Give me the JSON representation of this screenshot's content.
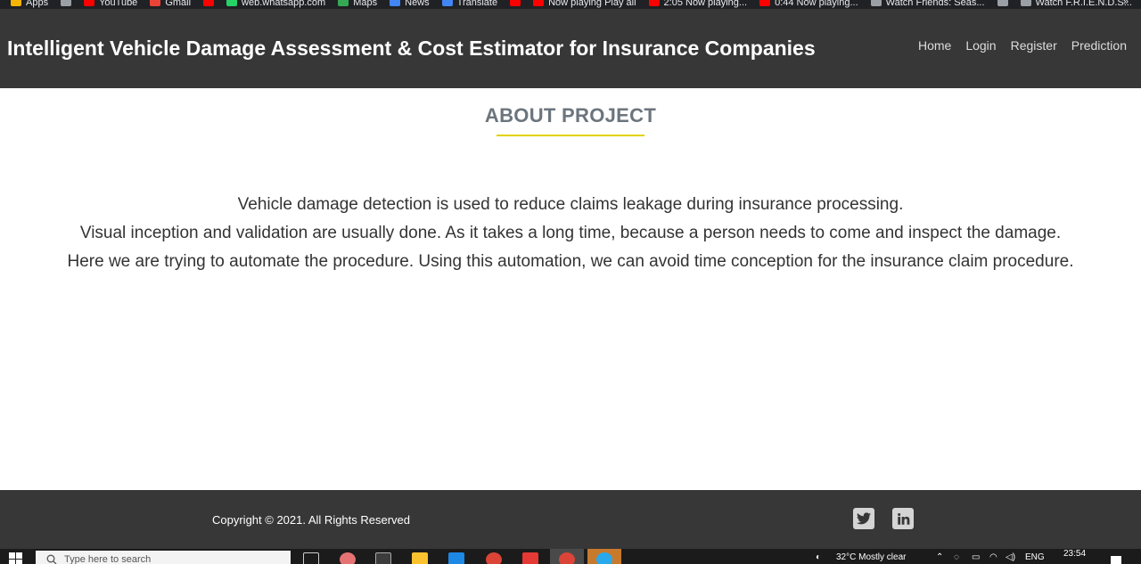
{
  "bookmarks": {
    "items": [
      {
        "label": "Apps",
        "color": "#f4b400"
      },
      {
        "label": "",
        "color": "#9aa0a6"
      },
      {
        "label": "YouTube",
        "color": "#ff0000"
      },
      {
        "label": "Gmail",
        "color": "#ea4335"
      },
      {
        "label": "",
        "color": "#ff0000"
      },
      {
        "label": "web.whatsapp.com",
        "color": "#25d366"
      },
      {
        "label": "Maps",
        "color": "#34a853"
      },
      {
        "label": "News",
        "color": "#4285f4"
      },
      {
        "label": "Translate",
        "color": "#4285f4"
      },
      {
        "label": "",
        "color": "#ff0000"
      },
      {
        "label": "Now playing Play all",
        "color": "#ff0000"
      },
      {
        "label": "2:05 Now playing...",
        "color": "#ff0000"
      },
      {
        "label": "0:44 Now playing...",
        "color": "#ff0000"
      },
      {
        "label": "Watch Friends: Seas...",
        "color": "#9aa0a6"
      },
      {
        "label": "",
        "color": "#9aa0a6"
      },
      {
        "label": "Watch F.R.I.E.N.D.S...",
        "color": "#9aa0a6"
      }
    ],
    "more_label": "»"
  },
  "header": {
    "title": "Intelligent Vehicle Damage Assessment & Cost Estimator for Insurance Companies",
    "nav": {
      "home": "Home",
      "login": "Login",
      "register": "Register",
      "prediction": "Prediction"
    }
  },
  "about": {
    "heading": "ABOUT PROJECT",
    "lines": [
      "Vehicle damage detection is used to reduce claims leakage during insurance processing.",
      "Visual inception and validation are usually done. As it takes a long time, because a person needs to come and inspect the damage.",
      "Here we are trying to automate the procedure. Using this automation, we can avoid time conception for the insurance claim procedure."
    ]
  },
  "footer": {
    "copyright": "Copyright © 2021. All Rights Reserved",
    "social": [
      {
        "icon": "twitter-icon"
      },
      {
        "icon": "linkedin-icon"
      }
    ]
  },
  "taskbar": {
    "search_placeholder": "Type here to search",
    "weather": "32°C  Mostly clear",
    "language": "ENG",
    "time": "23:54"
  },
  "colors": {
    "header_bg": "#373737",
    "accent_underline": "#e0d200",
    "heading_gray": "#6c757d"
  }
}
